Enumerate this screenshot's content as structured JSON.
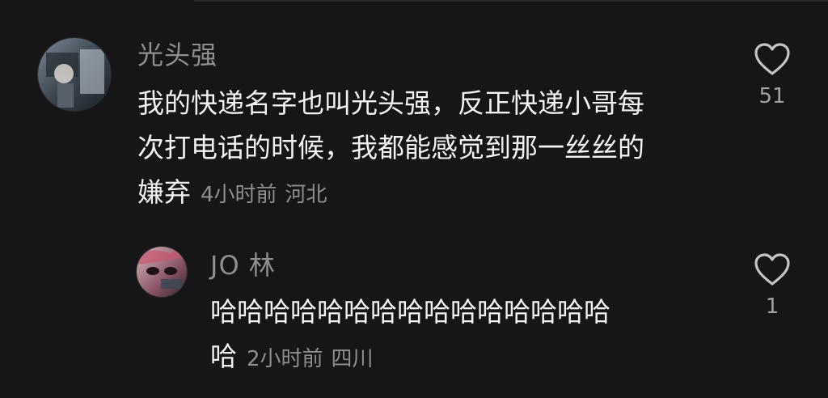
{
  "comments": [
    {
      "username": "光头强",
      "text_line1": "我的快递名字也叫光头强，反正快递小哥每",
      "text_line2": "次打电话的时候，我都能感觉到那一丝丝的",
      "text_line3": "嫌弃",
      "time": "4小时前",
      "location": "河北",
      "likes": "51",
      "like_icon": "heart-outline-icon"
    },
    {
      "username": "JO 林",
      "text_line1": "哈哈哈哈哈哈哈哈哈哈哈哈哈哈哈",
      "text_line2": "哈",
      "time": "2小时前",
      "location": "四川",
      "likes": "1",
      "like_icon": "heart-outline-icon"
    }
  ],
  "colors": {
    "background": "#161618",
    "text": "#f2f2f2",
    "secondary": "#8e8e93"
  }
}
